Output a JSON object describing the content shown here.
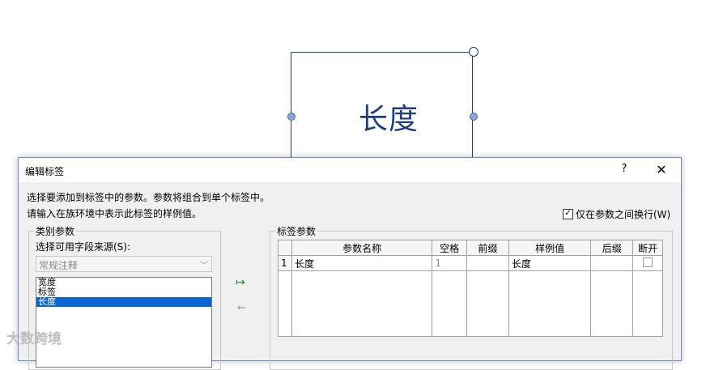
{
  "canvas": {
    "label_text": "长度"
  },
  "dialog": {
    "title": "编辑标签",
    "help": "?",
    "close": "✕",
    "instructions": [
      "选择要添加到标签中的参数。参数将组合到单个标签中。",
      "请输入在族环境中表示此标签的样例值。"
    ],
    "wrap_checkbox": {
      "label": "仅在参数之间换行(W)",
      "checked": true
    }
  },
  "category_params": {
    "group_title": "类别参数",
    "source_label": "选择可用字段来源(S):",
    "source_value": "常规注释",
    "fields": [
      {
        "label": "宽度",
        "selected": false
      },
      {
        "label": "标签",
        "selected": false
      },
      {
        "label": "长度",
        "selected": true
      }
    ]
  },
  "buttons": {
    "add_icon": "↦",
    "remove_icon": "←"
  },
  "label_params": {
    "group_title": "标签参数",
    "columns": [
      "参数名称",
      "空格",
      "前缀",
      "样例值",
      "后缀",
      "断开"
    ],
    "rows": [
      {
        "index": "1",
        "name": "长度",
        "spaces": "1",
        "prefix": "",
        "sample": "长度",
        "suffix": "",
        "break": false
      }
    ]
  },
  "watermark": "大数跨境"
}
